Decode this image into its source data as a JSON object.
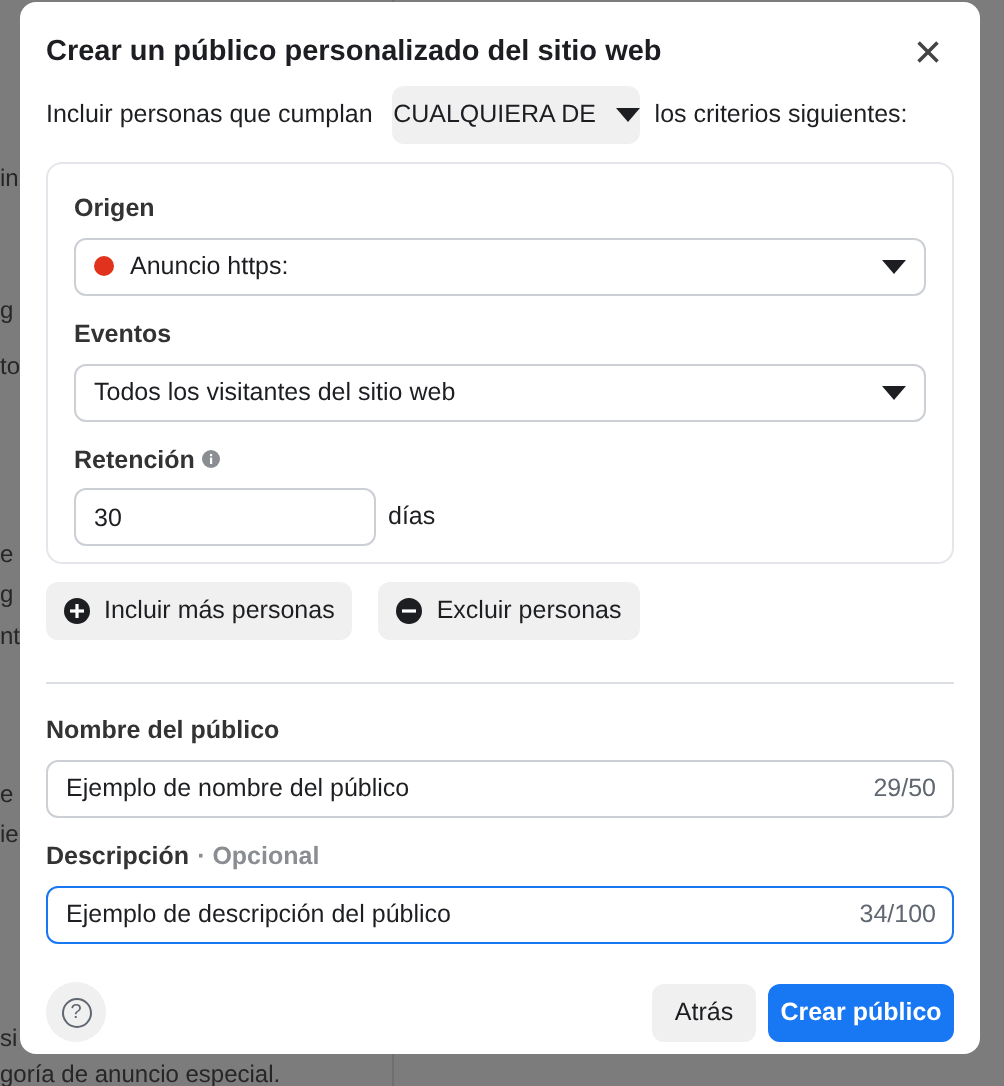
{
  "background_fragments": [
    "in",
    "g",
    "to",
    "e",
    "g",
    "nt",
    "e",
    "ie",
    "si",
    "goría de anuncio especial."
  ],
  "dialog": {
    "title": "Crear un público personalizado del sitio web",
    "close": "×"
  },
  "criteria": {
    "prefix": "Incluir personas que cumplan",
    "match": "CUALQUIERA DE",
    "suffix": "los criterios siguientes:"
  },
  "rule": {
    "origin": {
      "label": "Origen",
      "value": "Anuncio https:",
      "color": "#e0321c"
    },
    "events": {
      "label": "Eventos",
      "value": "Todos los visitantes del sitio web"
    },
    "retention": {
      "label": "Retención",
      "value": "30",
      "unit": "días"
    }
  },
  "actions": [
    {
      "kind": "include",
      "label": "Incluir más personas"
    },
    {
      "kind": "exclude",
      "label": "Excluir personas"
    }
  ],
  "name_field": {
    "label": "Nombre del público",
    "value": "Ejemplo de nombre del público",
    "counter": "29/50",
    "focused": false
  },
  "description_field": {
    "label": "Descripción",
    "optional": "· Opcional",
    "value": "Ejemplo de descripción del público",
    "counter": "34/100",
    "focused": true
  },
  "footer": {
    "help": "?",
    "back": "Atrás",
    "submit": "Crear público"
  }
}
